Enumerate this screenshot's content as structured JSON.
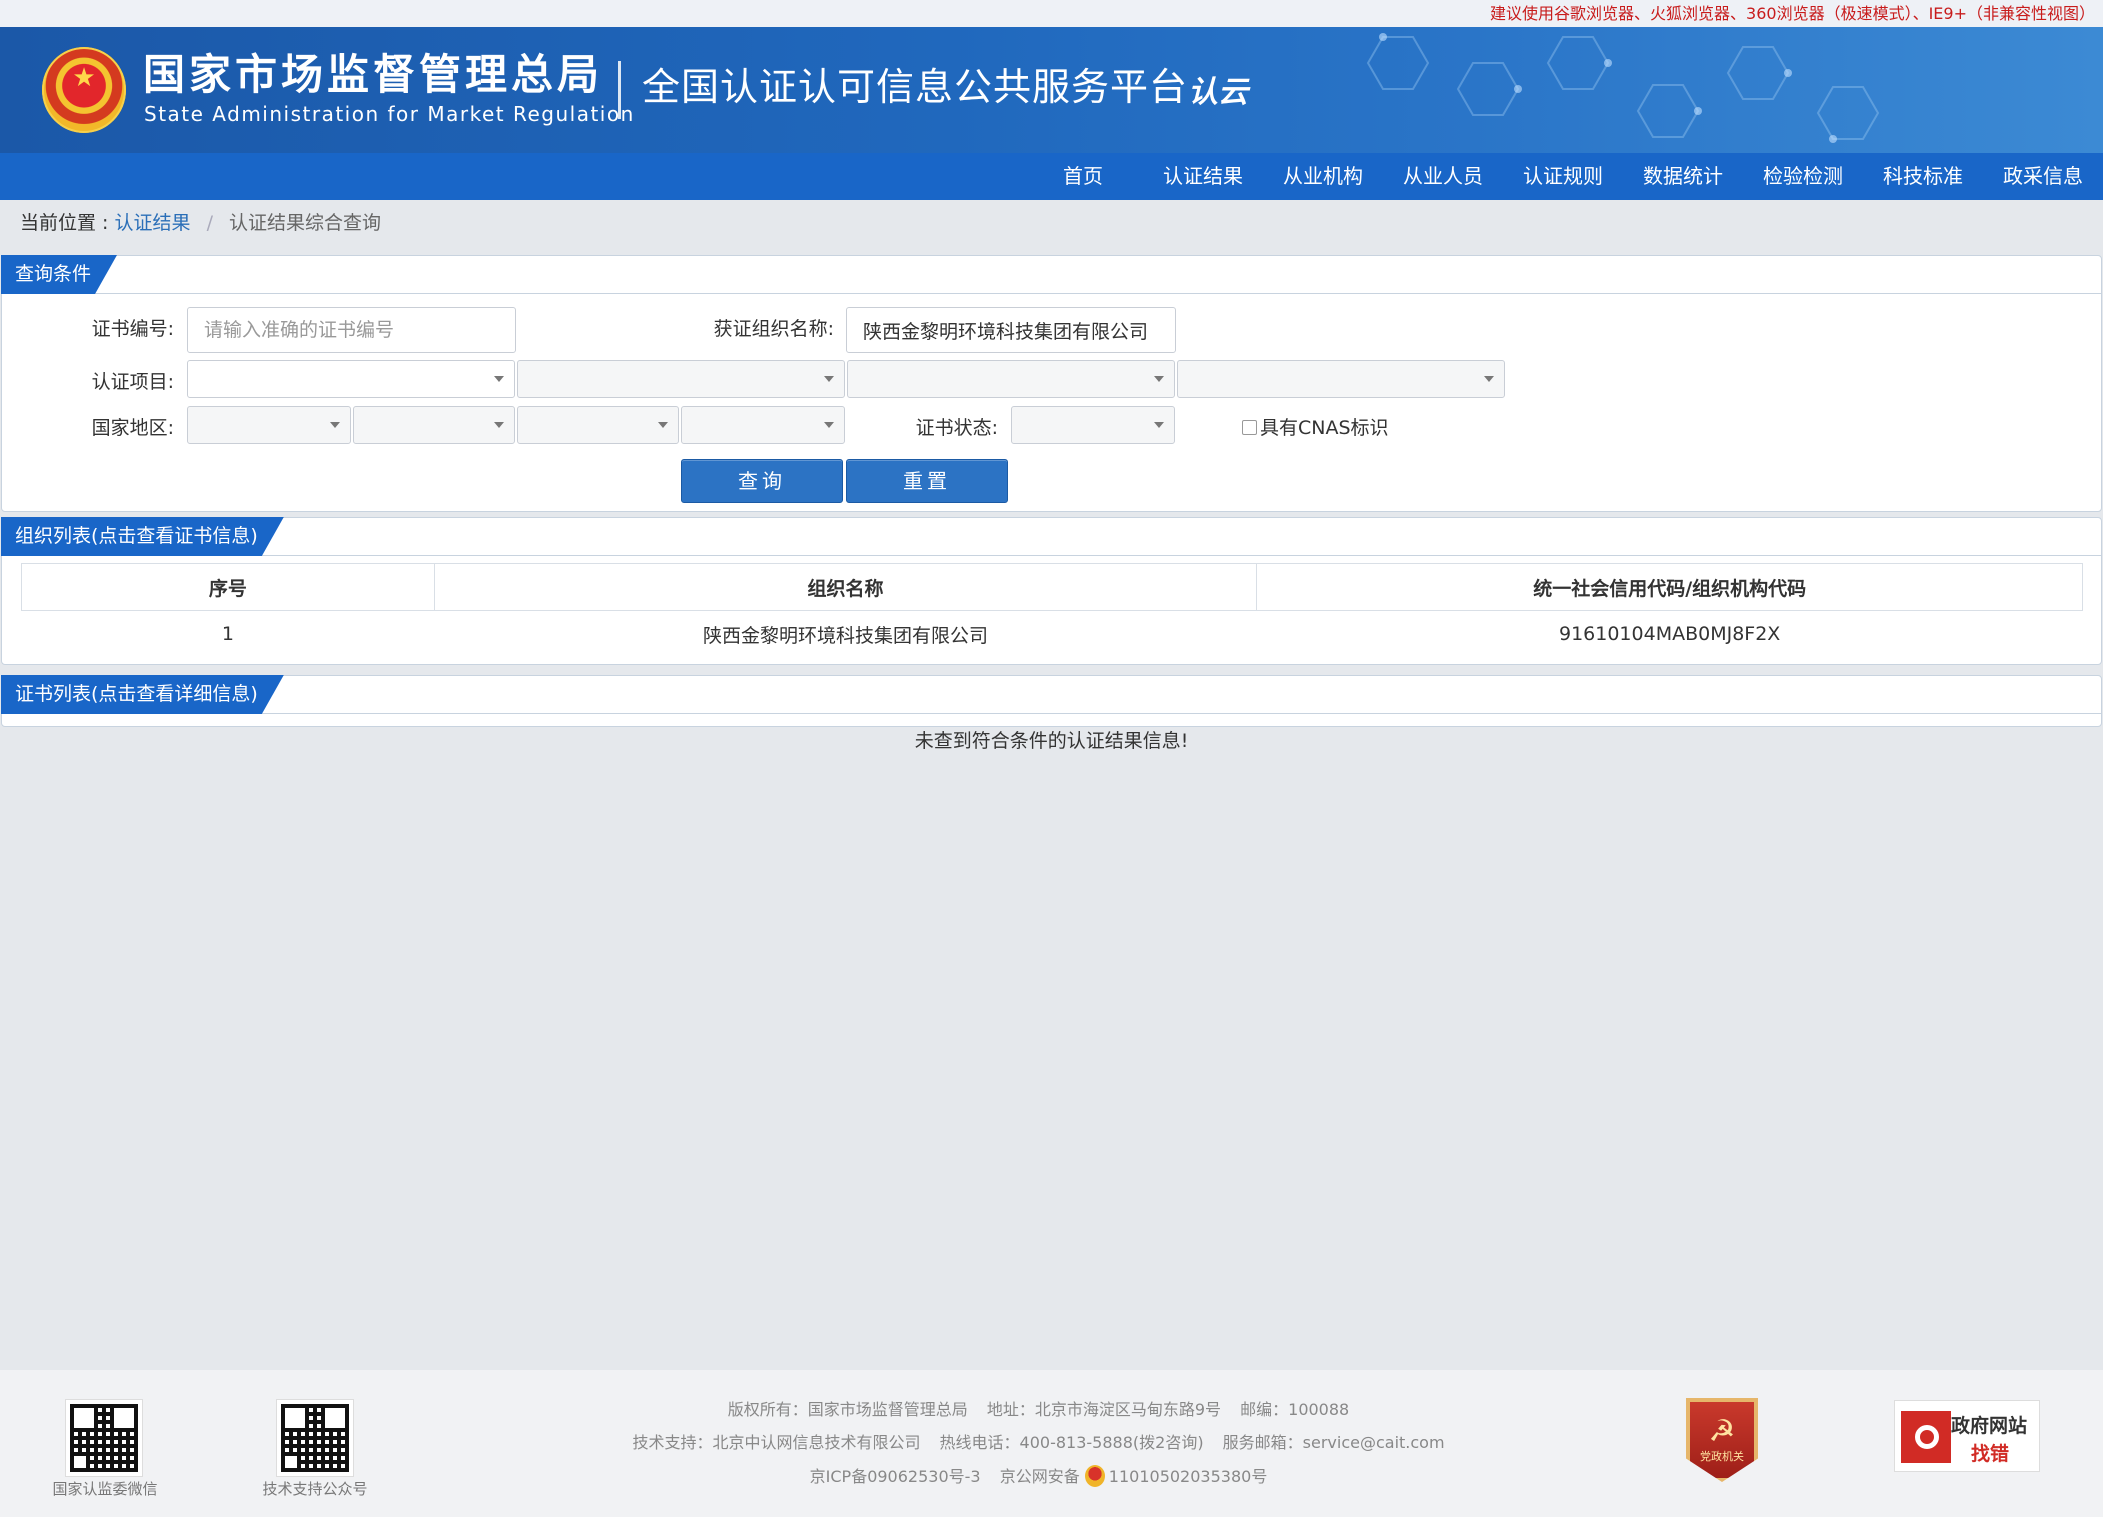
{
  "notice": "建议使用谷歌浏览器、火狐浏览器、360浏览器（极速模式）、IE9+（非兼容性视图）",
  "header": {
    "agency_cn": "国家市场监督管理总局",
    "agency_en": "State Administration  for  Market Regulation",
    "platform_title": "全国认证认可信息公共服务平台",
    "cloud_logo": "认云"
  },
  "nav": [
    "首页",
    "认证结果",
    "从业机构",
    "从业人员",
    "认证规则",
    "数据统计",
    "检验检测",
    "科技标准",
    "政采信息"
  ],
  "breadcrumb": {
    "prefix": "当前位置 :",
    "link": "认证结果",
    "separator": "/",
    "current": "认证结果综合查询"
  },
  "query": {
    "tab": "查询条件",
    "cert_no_label": "证书编号:",
    "cert_no_placeholder": "请输入准确的证书编号",
    "org_label": "获证组织名称:",
    "org_value": "陕西金黎明环境科技集团有限公司",
    "project_label": "认证项目:",
    "region_label": "国家地区:",
    "status_label": "证书状态:",
    "cnas_label": "具有CNAS标识",
    "search_button": "查询",
    "reset_button": "重置"
  },
  "org_list": {
    "tab": "组织列表(点击查看证书信息)",
    "columns": [
      "序号",
      "组织名称",
      "统一社会信用代码/组织机构代码"
    ],
    "rows": [
      [
        "1",
        "陕西金黎明环境科技集团有限公司",
        "91610104MAB0MJ8F2X"
      ]
    ]
  },
  "cert_list": {
    "tab": "证书列表(点击查看详细信息)",
    "empty": "未查到符合条件的认证结果信息!"
  },
  "footer": {
    "qr1_caption": "国家认监委微信",
    "qr2_caption": "技术支持公众号",
    "copyright": "版权所有：国家市场监督管理总局",
    "address": "地址：北京市海淀区马甸东路9号",
    "postcode": "邮编：100088",
    "tech_support": "技术支持：北京中认网信息技术有限公司",
    "hotline": "热线电话：400-813-5888(拨2咨询)",
    "email": "服务邮箱：service@cait.com",
    "icp": "京ICP备09062530号-3",
    "police_prefix": "京公网安备",
    "police_no": "11010502035380号",
    "party_badge": "党政机关",
    "gov_badge_1": "政府网站",
    "gov_badge_2": "找错"
  },
  "colors": {
    "brand_blue": "#1966c8",
    "notice_red": "#c81c1c",
    "link_blue": "#2b6fb8"
  }
}
